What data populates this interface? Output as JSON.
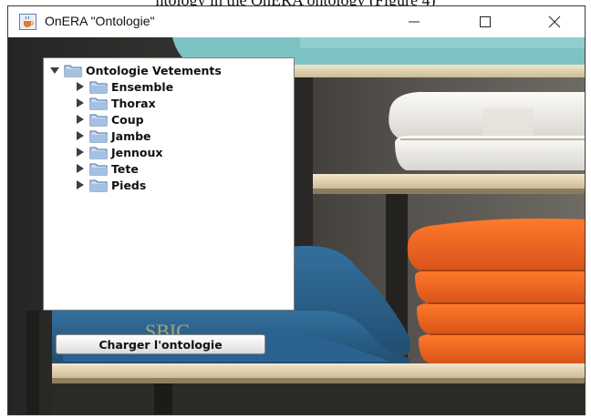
{
  "caption_partial": "ntology in the OnERA ontology (Figure 4)",
  "window": {
    "title": "OnERA \"Ontologie\"",
    "app_icon": "java-cup-icon",
    "controls": {
      "minimize_icon": "minimize-icon",
      "maximize_icon": "maximize-icon",
      "close_icon": "close-icon"
    }
  },
  "tree": {
    "root": {
      "label": "Ontologie Vetements",
      "expanded": true,
      "icon": "folder-icon"
    },
    "children": [
      {
        "label": "Ensemble",
        "expanded": false
      },
      {
        "label": "Thorax",
        "expanded": false
      },
      {
        "label": "Coup",
        "expanded": false
      },
      {
        "label": "Jambe",
        "expanded": false
      },
      {
        "label": "Jennoux",
        "expanded": false
      },
      {
        "label": "Tete",
        "expanded": false
      },
      {
        "label": "Pieds",
        "expanded": false
      }
    ]
  },
  "load_button": {
    "label": "Charger l'ontologie"
  },
  "background": {
    "description_icon": "clothing-shelf-photo",
    "colors": {
      "orange_shirts": "#f06a1e",
      "white_shirts": "#f2f0ec",
      "blue_shirts": "#2c5f88",
      "shelf_wood": "#e8d9b8",
      "teal_fabric": "#7ec3c3"
    }
  }
}
